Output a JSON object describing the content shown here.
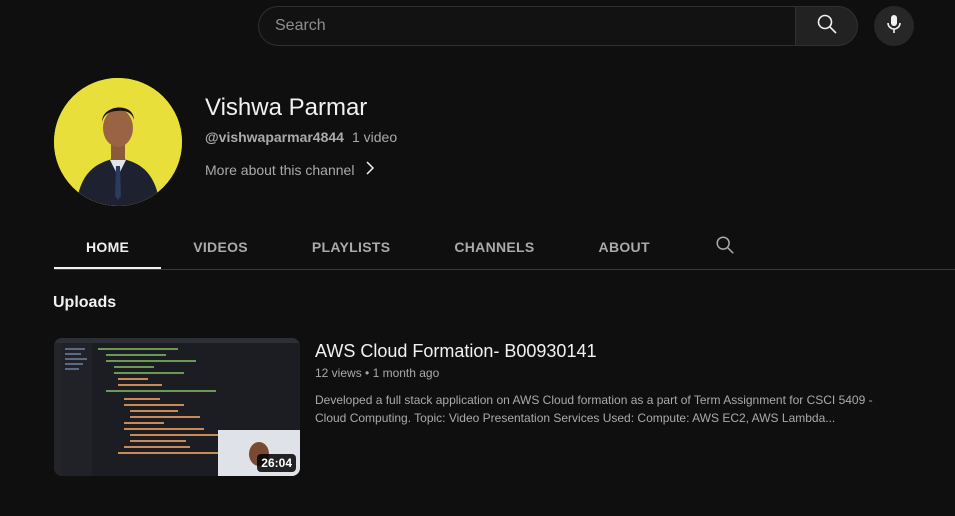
{
  "search": {
    "placeholder": "Search"
  },
  "icons": {
    "search": "search-icon",
    "mic": "microphone-icon",
    "chevron": "chevron-right-icon",
    "tab_search": "search-icon"
  },
  "channel": {
    "name": "Vishwa Parmar",
    "handle": "@vishwaparmar4844",
    "video_count": "1 video",
    "more_about": "More about this channel",
    "avatar_bg": "#e8df3a"
  },
  "tabs": [
    {
      "label": "HOME",
      "active": true
    },
    {
      "label": "VIDEOS",
      "active": false
    },
    {
      "label": "PLAYLISTS",
      "active": false
    },
    {
      "label": "CHANNELS",
      "active": false
    },
    {
      "label": "ABOUT",
      "active": false
    }
  ],
  "uploads": {
    "title": "Uploads",
    "videos": [
      {
        "title": "AWS Cloud Formation- B00930141",
        "views": "12 views",
        "age": "1 month ago",
        "duration": "26:04",
        "description": "Developed a full stack application on AWS Cloud formation as a part of Term Assignment for CSCI 5409 - Cloud Computing. Topic: Video Presentation Services Used: Compute: AWS EC2, AWS Lambda..."
      }
    ]
  }
}
